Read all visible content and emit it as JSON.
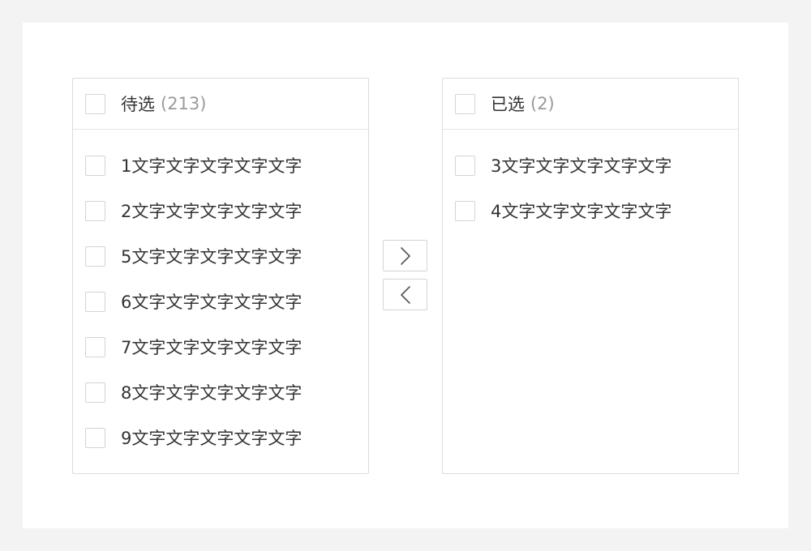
{
  "source_panel": {
    "title": "待选",
    "count": "(213)",
    "items": [
      {
        "label": "1文字文字文字文字文字"
      },
      {
        "label": "2文字文字文字文字文字"
      },
      {
        "label": "5文字文字文字文字文字"
      },
      {
        "label": "6文字文字文字文字文字"
      },
      {
        "label": "7文字文字文字文字文字"
      },
      {
        "label": "8文字文字文字文字文字"
      },
      {
        "label": "9文字文字文字文字文字"
      }
    ]
  },
  "target_panel": {
    "title": "已选",
    "count": "(2)",
    "items": [
      {
        "label": "3文字文字文字文字文字"
      },
      {
        "label": "4文字文字文字文字文字"
      }
    ]
  },
  "transfer_buttons": {
    "to_right_icon": "chevron-right-icon",
    "to_left_icon": "chevron-left-icon"
  },
  "colors": {
    "page_background": "#f3f3f3",
    "card_background": "#ffffff",
    "border": "#dcdcdc",
    "text": "#333333",
    "count_text": "#9a9a9a"
  }
}
